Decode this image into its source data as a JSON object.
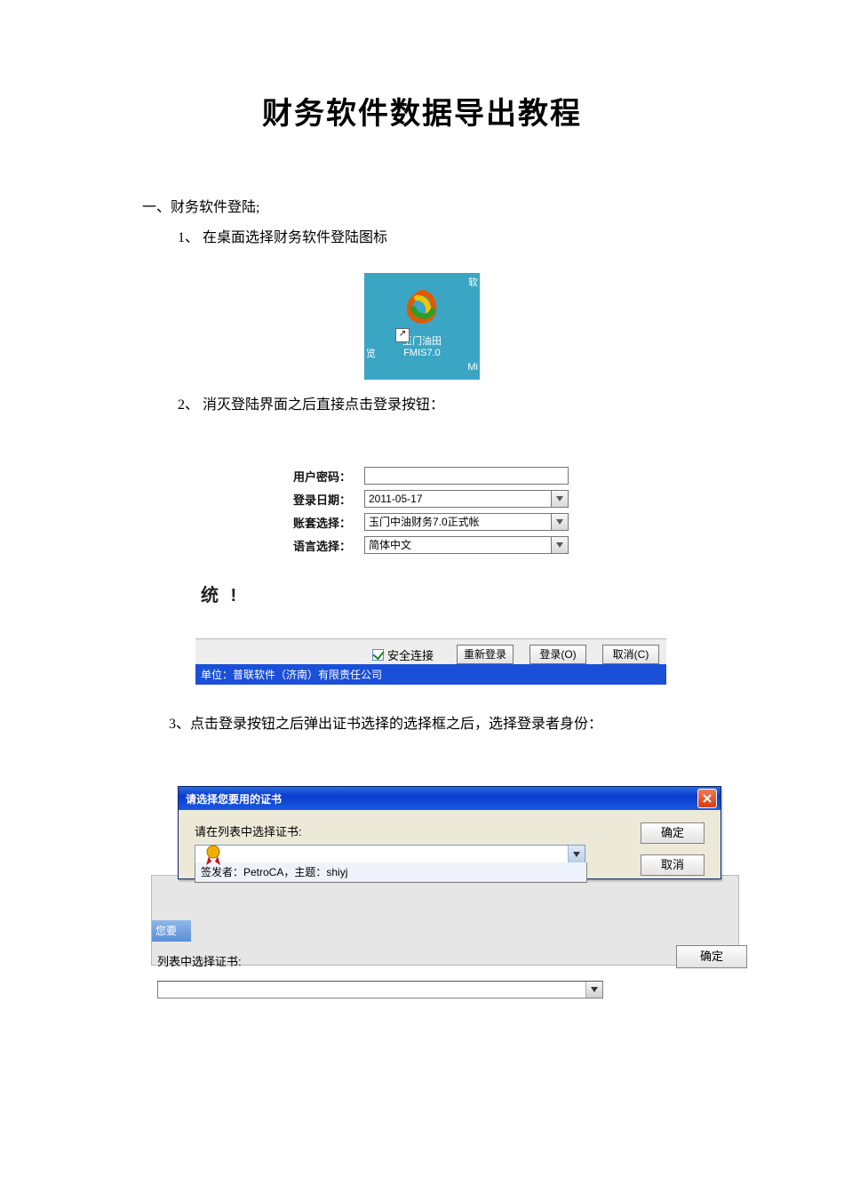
{
  "doc": {
    "title": "财务软件数据导出教程",
    "section1": "一、财务软件登陆;",
    "step1": "1、 在桌面选择财务软件登陆图标",
    "step2": "2、 消灭登陆界面之后直接点击登录按钮：",
    "step3": "3、点击登录按钮之后弹出证书选择的选择框之后，选择登录者身份："
  },
  "desktop": {
    "icon_line1": "玉门油田",
    "icon_line2": "FMIS7.0",
    "frag_tr": "软",
    "frag_bl": "览",
    "frag_br": "Mi"
  },
  "login": {
    "labels": {
      "password": "用户密码：",
      "date": "登录日期：",
      "account": "账套选择：",
      "language": "语言选择："
    },
    "values": {
      "password": "",
      "date": "2011-05-17",
      "account": "玉门中油财务7.0正式帐",
      "language": "简体中文"
    },
    "tong": "统 !",
    "secure": "安全连接",
    "buttons": {
      "relogin": "重新登录",
      "login": "登录(O)",
      "cancel": "取消(C)"
    },
    "footer": "单位：普联软件（济南）有限责任公司"
  },
  "cert": {
    "bg_strip": "您要",
    "bg_label": "列表中选择证书:",
    "bg_ok": "确定",
    "title": "请选择您要用的证书",
    "prompt": "请在列表中选择证书:",
    "option": "签发者：PetroCA，主题：shiyj",
    "ok": "确定",
    "cancel": "取消"
  }
}
